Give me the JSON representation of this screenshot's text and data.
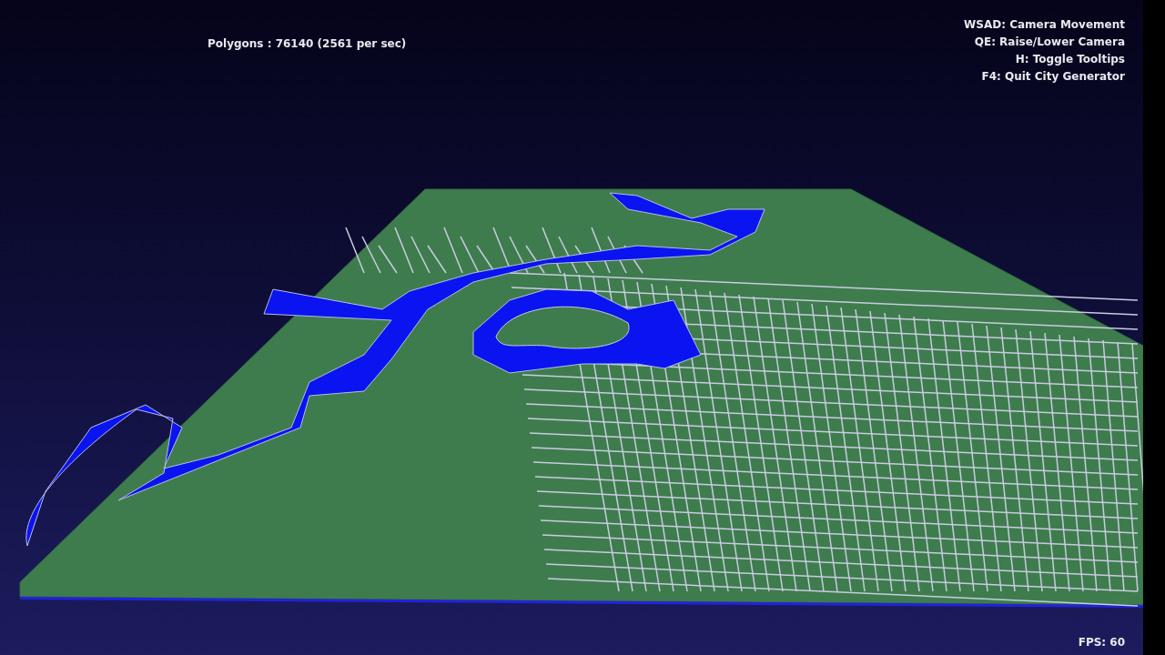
{
  "stats": {
    "polygons": "Polygons : 76140 (2561 per sec)"
  },
  "controls_help": [
    "WSAD: Camera Movement",
    "QE: Raise/Lower Camera",
    "H: Toggle Tooltips",
    "F4: Quit City Generator"
  ],
  "fps": "FPS: 60"
}
